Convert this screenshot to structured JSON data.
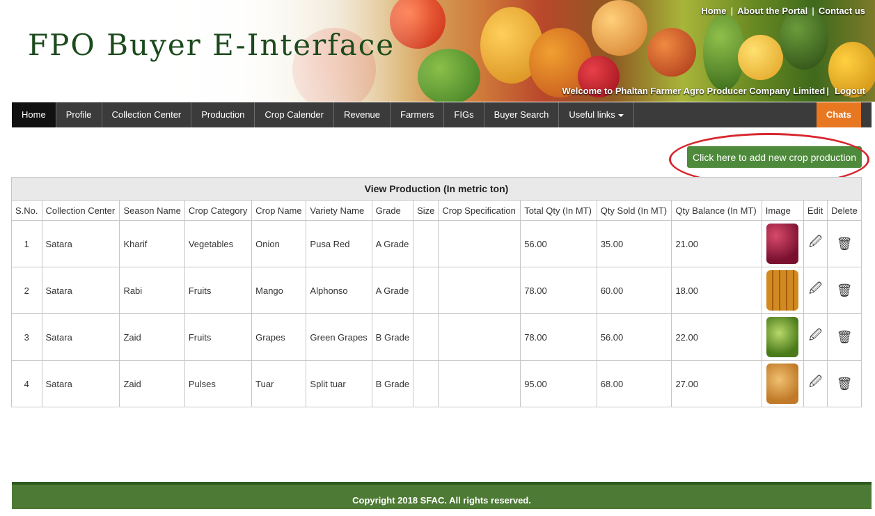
{
  "header": {
    "site_title": "FPO Buyer E-Interface",
    "top_links": [
      "Home",
      "About the Portal",
      "Contact us"
    ],
    "welcome_text": "Welcome to Phaltan Farmer Agro Producer Company Limited",
    "logout_label": "Logout"
  },
  "nav": {
    "items": [
      "Home",
      "Profile",
      "Collection Center",
      "Production",
      "Crop Calender",
      "Revenue",
      "Farmers",
      "FIGs",
      "Buyer Search",
      "Useful links"
    ],
    "active": "Home",
    "chats_label": "Chats"
  },
  "actions": {
    "add_button_label": "Click here to add new crop production"
  },
  "table": {
    "title": "View Production (In metric ton)",
    "columns": [
      "S.No.",
      "Collection Center",
      "Season Name",
      "Crop Category",
      "Crop Name",
      "Variety Name",
      "Grade",
      "Size",
      "Crop Specification",
      "Total Qty (In MT)",
      "Qty Sold (In MT)",
      "Qty Balance (In MT)",
      "Image",
      "Edit",
      "Delete"
    ],
    "rows": [
      {
        "sno": "1",
        "center": "Satara",
        "season": "Kharif",
        "category": "Vegetables",
        "crop": "Onion",
        "variety": "Pusa Red",
        "grade": "A Grade",
        "size": "",
        "spec": "",
        "total": "56.00",
        "sold": "35.00",
        "balance": "21.00",
        "image": "onion-image"
      },
      {
        "sno": "2",
        "center": "Satara",
        "season": "Rabi",
        "category": "Fruits",
        "crop": "Mango",
        "variety": "Alphonso",
        "grade": "A Grade",
        "size": "",
        "spec": "",
        "total": "78.00",
        "sold": "60.00",
        "balance": "18.00",
        "image": "mango-image"
      },
      {
        "sno": "3",
        "center": "Satara",
        "season": "Zaid",
        "category": "Fruits",
        "crop": "Grapes",
        "variety": "Green Grapes",
        "grade": "B Grade",
        "size": "",
        "spec": "",
        "total": "78.00",
        "sold": "56.00",
        "balance": "22.00",
        "image": "grapes-image"
      },
      {
        "sno": "4",
        "center": "Satara",
        "season": "Zaid",
        "category": "Pulses",
        "crop": "Tuar",
        "variety": "Split tuar",
        "grade": "B Grade",
        "size": "",
        "spec": "",
        "total": "95.00",
        "sold": "68.00",
        "balance": "27.00",
        "image": "tuar-image"
      }
    ],
    "edit_icon": "edit-icon",
    "delete_icon": "trash-icon"
  },
  "footer": {
    "copyright": "Copyright 2018 SFAC. All rights reserved."
  },
  "colors": {
    "nav_bg": "#3b3b3b",
    "chats_bg": "#e87722",
    "button_green": "#4e8a3b",
    "footer_green": "#4d7a35",
    "highlight_red": "#d7262d",
    "title_green": "#1c4a1c"
  }
}
